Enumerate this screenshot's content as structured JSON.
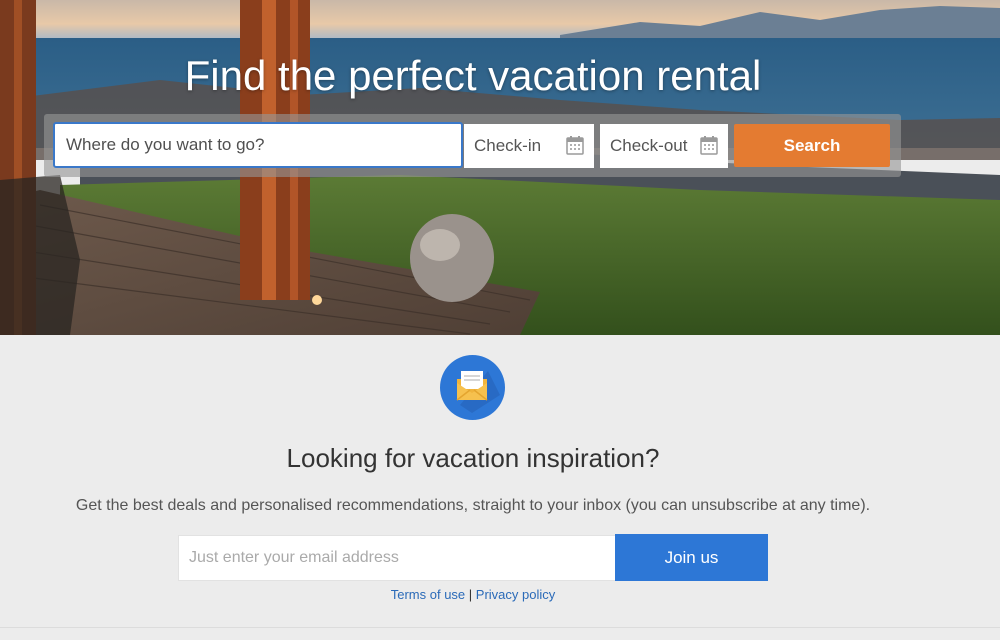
{
  "hero": {
    "title": "Find the perfect vacation rental",
    "destination_placeholder": "Where do you want to go?",
    "checkin_label": "Check-in",
    "checkout_label": "Check-out",
    "search_label": "Search",
    "calendar_icon": "calendar-icon"
  },
  "newsletter": {
    "icon": "envelope-icon",
    "heading": "Looking for vacation inspiration?",
    "subtext": "Get the best deals and personalised recommendations, straight to your inbox (you can unsubscribe at any time).",
    "email_placeholder": "Just enter your email address",
    "join_label": "Join us",
    "terms_label": "Terms of use",
    "separator": "|",
    "privacy_label": "Privacy policy"
  },
  "colors": {
    "search_button": "#e47b31",
    "join_button": "#2d77d6",
    "link": "#2a6ab8",
    "mail_circle": "#2d77d6"
  }
}
